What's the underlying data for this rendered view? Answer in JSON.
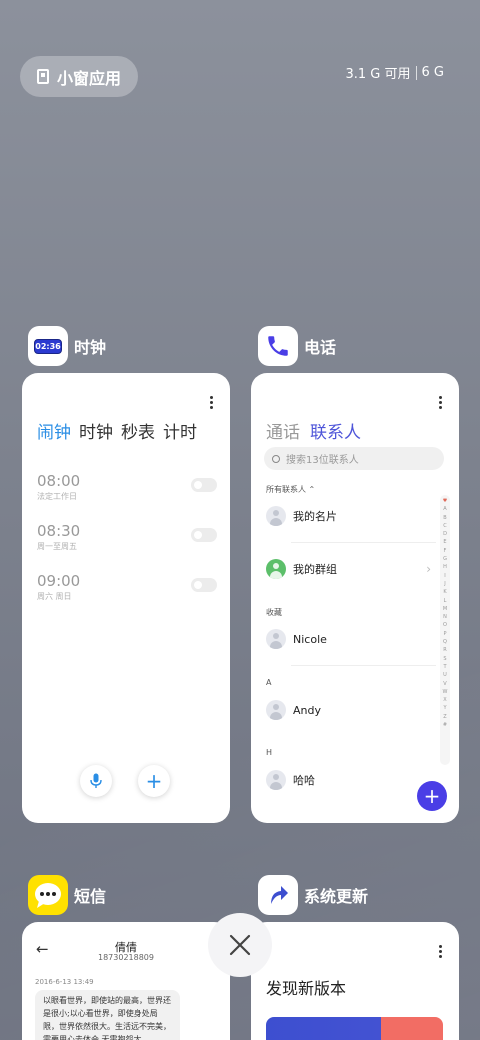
{
  "top": {
    "mini_window_label": "小窗应用",
    "memory": "3.1 G 可用",
    "total": "6 G"
  },
  "clock": {
    "app_name": "时钟",
    "icon_time": "02:36",
    "tabs": [
      "闹钟",
      "时钟",
      "秒表",
      "计时"
    ],
    "alarms": [
      {
        "time": "08:00",
        "desc": "法定工作日"
      },
      {
        "time": "08:30",
        "desc": "周一至周五"
      },
      {
        "time": "09:00",
        "desc": "周六 周日"
      }
    ],
    "mic_icon": "mic-icon",
    "add_symbol": "+"
  },
  "phone": {
    "app_name": "电话",
    "tabs": [
      "通话",
      "联系人"
    ],
    "search_placeholder": "搜索13位联系人",
    "all_contacts": "所有联系人 ⌃",
    "my_card": "我的名片",
    "my_group": "我的群组",
    "favorites_header": "收藏",
    "favorite": "Nicole",
    "section_a": "A",
    "contact_a": "Andy",
    "section_h": "H",
    "contact_h": "哈哈",
    "alphabet": "♥ A B C D E F G H I J K L M N O P Q R S T U V W X Y Z #",
    "add_symbol": "+"
  },
  "sms": {
    "app_name": "短信",
    "contact_name": "倩倩",
    "contact_number": "18730218809",
    "date": "2016-6-13 13:49",
    "message": "以眼看世界，即使站的最高，世界还是很小;以心看世界，即使身处局限，世界依然很大。生活远不完美，需要用心去体会,无需抱怨太"
  },
  "update": {
    "app_name": "系统更新",
    "title": "发现新版本"
  },
  "colors": {
    "clock_accent": "#2a8ee5",
    "phone_accent": "#4e55d9",
    "phone_icon": "#4a3ee6",
    "sms_icon": "#ffe100"
  }
}
